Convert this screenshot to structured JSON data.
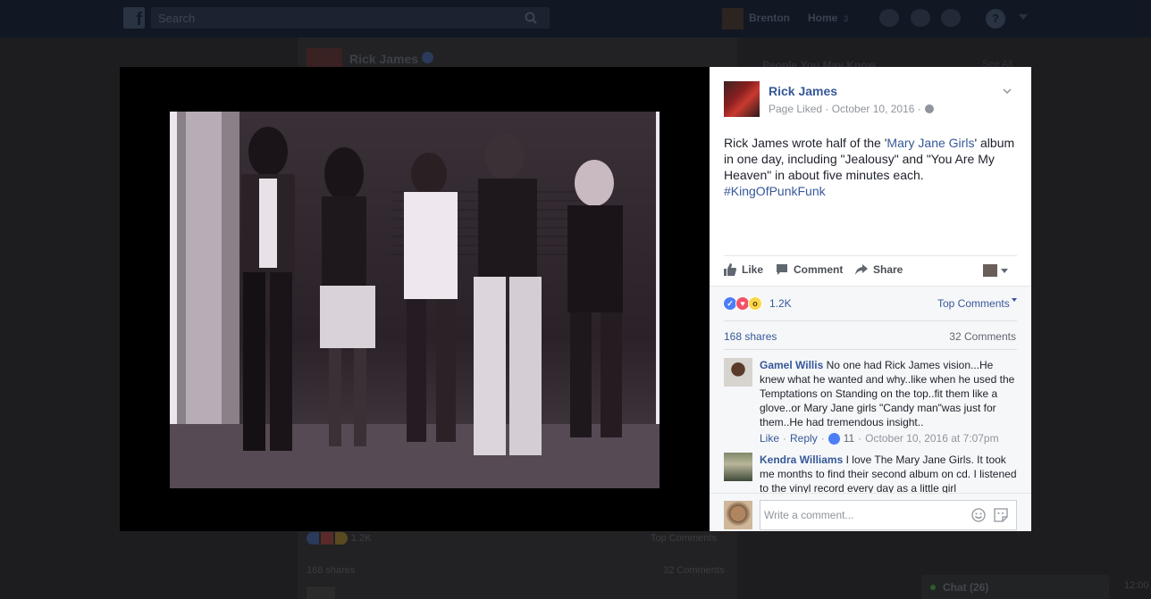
{
  "topbar": {
    "search_placeholder": "Search",
    "user_name": "Brenton",
    "home_label": "Home",
    "home_count": "3",
    "help_glyph": "?"
  },
  "background": {
    "post_author": "Rick James",
    "people_you_may_know": "People You May Know",
    "see_all": "See All",
    "reactions_count": "1.2K",
    "top_comments": "Top Comments",
    "shares": "168 shares",
    "comments": "32 Comments",
    "chat_label": "Chat (26)",
    "time_right": "12:00"
  },
  "post": {
    "page_name": "Rick James",
    "meta_liked": "Page Liked",
    "meta_date": "October 10, 2016",
    "text_before": "Rick James wrote half of the '",
    "text_link": "Mary Jane Girls",
    "text_after": "' album in one day, including \"Jealousy\" and \"You Are My Heaven\" in about five minutes each.",
    "hashtag": "#KingOfPunkFunk"
  },
  "actions": {
    "like": "Like",
    "comment": "Comment",
    "share": "Share"
  },
  "feedback": {
    "reactions_count": "1.2K",
    "top_comments": "Top Comments",
    "shares": "168 shares",
    "comments_count": "32 Comments"
  },
  "comments": [
    {
      "author": "Gamel Willis",
      "text": "No one had Rick James vision...He knew what he wanted and why..like when he used the Temptations on Standing on the top..fit them like a glove..or Mary Jane girls \"Candy man\"was just for them..He had tremendous insight..",
      "like_label": "Like",
      "reply_label": "Reply",
      "likes": "11",
      "timestamp": "October 10, 2016 at 7:07pm"
    },
    {
      "author": "Kendra Williams",
      "text": "I love The Mary Jane Girls. It took me months to find their second album on cd. I listened to the vinyl record every day as a little girl"
    }
  ],
  "composer": {
    "placeholder": "Write a comment..."
  }
}
